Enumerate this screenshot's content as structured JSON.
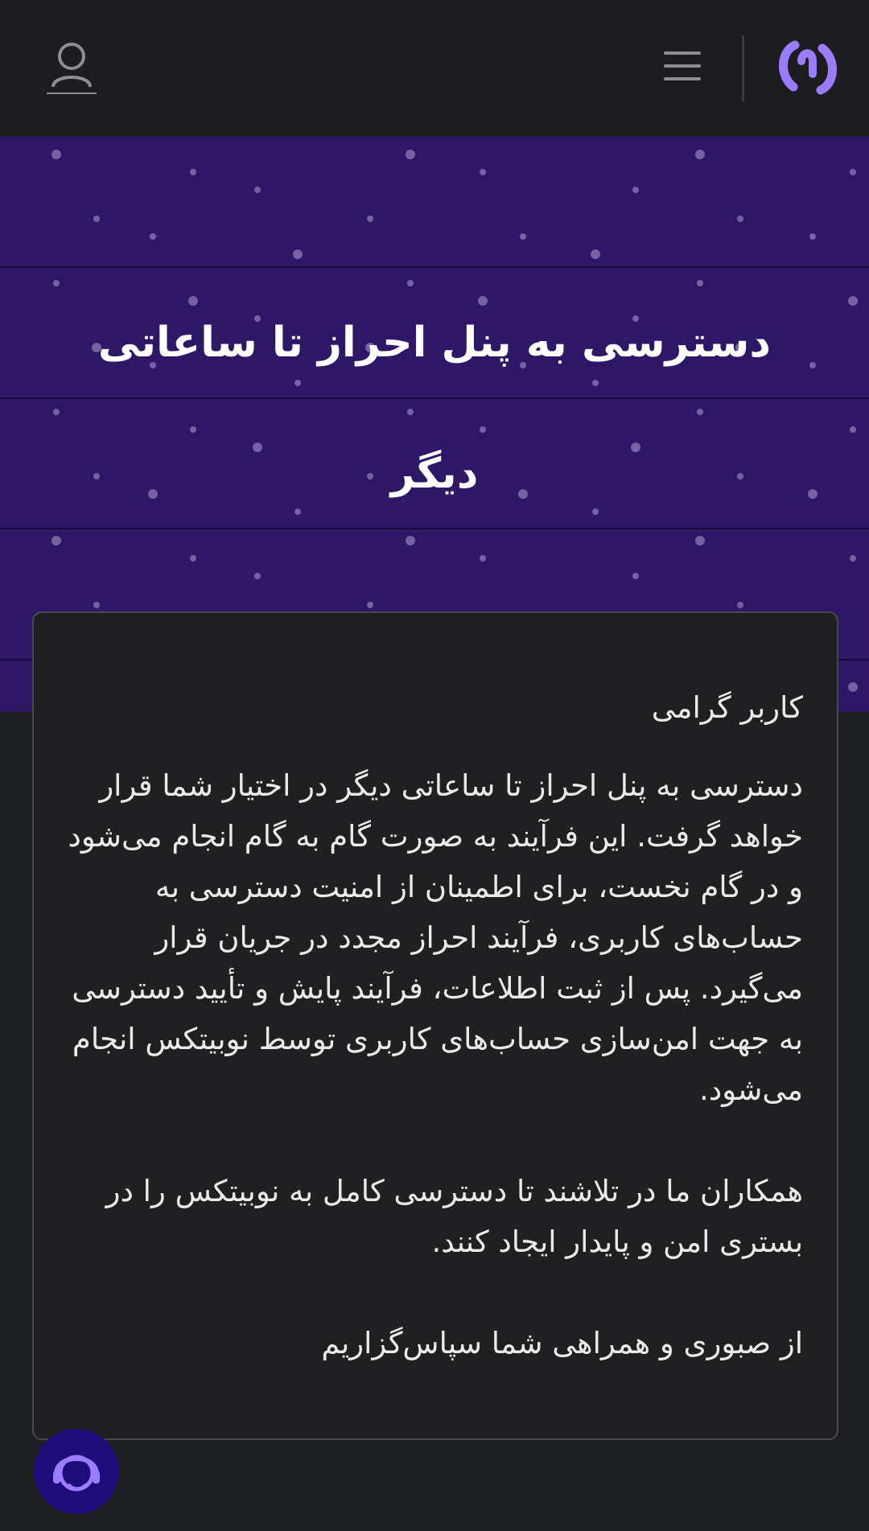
{
  "header": {
    "logo_icon": "nobitex-logo-icon",
    "menu_icon": "hamburger-menu-icon",
    "user_icon": "user-account-icon"
  },
  "hero": {
    "title": "دسترسی به پنل احراز تا ساعاتی دیگر"
  },
  "notice": {
    "greeting": "کاربر گرامی",
    "paragraph1": "دسترسی به پنل احراز تا ساعاتی دیگر در اختیار شما قرار خواهد گرفت. این فرآیند به صورت گام به گام انجام می‌شود و در گام نخست، برای اطمینان از امنیت دسترسی به حساب‌های کاربری، فرآیند احراز مجدد در جریان قرار می‌گیرد. پس از ثبت اطلاعات، فرآیند پایش و تأیید دسترسی به جهت امن‌سازی حساب‌های کاربری توسط نوبیتکس انجام می‌شود.",
    "paragraph2": "همکاران ما در تلاشند تا دسترسی کامل به نوبیتکس را در بستری امن و پایدار ایجاد کنند.",
    "closing": "از صبوری و همراهی شما سپاس‌گزاریم"
  },
  "support": {
    "icon": "support-headset-icon"
  },
  "colors": {
    "header_bg": "#1d1d1f",
    "hero_bg": "#2e1766",
    "page_bg": "#1f2022",
    "accent": "#9b7bff",
    "support_bg": "#1e0c7a"
  }
}
